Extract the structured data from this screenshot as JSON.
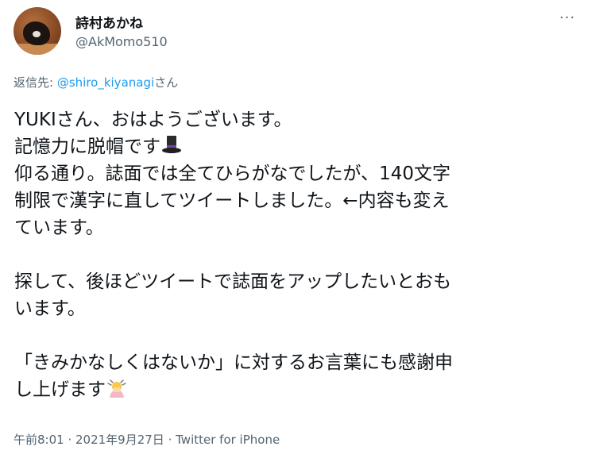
{
  "author": {
    "display_name": "詩村あかね",
    "handle": "@AkMomo510"
  },
  "more_icon": "ellipsis-icon",
  "reply": {
    "prefix": "返信先: ",
    "mention": "@shiro_kiyanagi",
    "suffix": "さん"
  },
  "tweet": {
    "line1": "YUKIさん、おはようございます。",
    "line2": "記憶力に脱帽です",
    "line2_emoji": "top-hat-icon",
    "line3": "仰る通り。誌面では全てひらがなでしたが、140文字",
    "line4": "制限で漢字に直してツイートしました。←内容も変え",
    "line5": "ています。",
    "line6": "探して、後ほどツイートで誌面をアップしたいとおも",
    "line7": "います。",
    "line8": "「きみかなしくはないか」に対するお言葉にも感謝申",
    "line9": "し上げます",
    "line9_emoji": "bowing-person-icon"
  },
  "meta": {
    "time": "午前8:01",
    "separator1": " · ",
    "date": "2021年9月27日",
    "separator2": " · ",
    "source": "Twitter for iPhone"
  },
  "colors": {
    "text": "#0f1419",
    "secondary": "#536471",
    "link": "#1d9bf0"
  }
}
